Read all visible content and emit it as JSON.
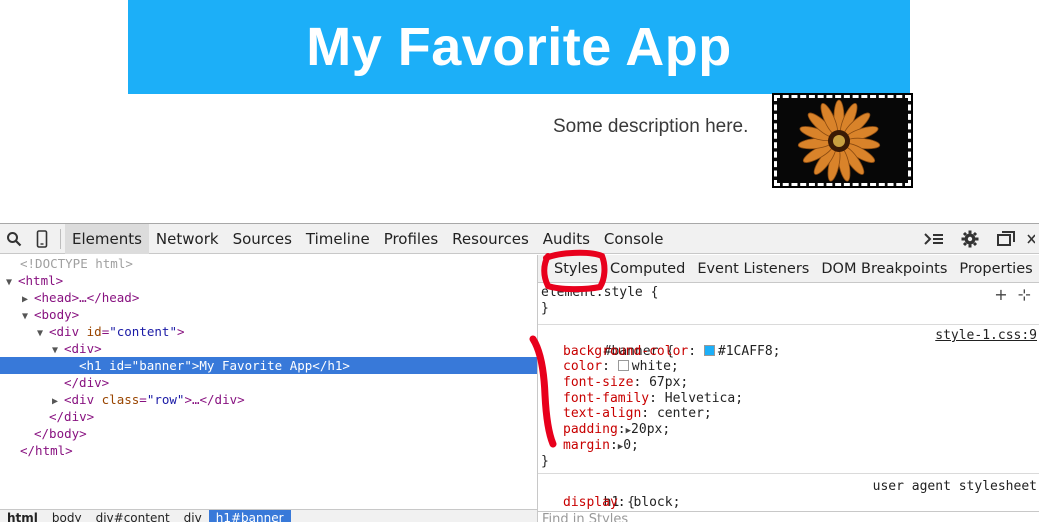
{
  "page": {
    "banner_text": "My Favorite App",
    "description": "Some description here.",
    "image_alt": "flower-image"
  },
  "toolbar": {
    "tabs": [
      "Elements",
      "Network",
      "Sources",
      "Timeline",
      "Profiles",
      "Resources",
      "Audits",
      "Console"
    ],
    "active_tab": "Elements"
  },
  "dom_tree": {
    "doctype": "<!DOCTYPE html>",
    "html_open": "<html>",
    "head": "<head>…</head>",
    "body_open": "<body>",
    "div_content_tag": "<div ",
    "div_content_attr": "id",
    "div_content_val": "\"content\"",
    "div_content_close": ">",
    "div_open": "<div>",
    "h1_line": "<h1 id=\"banner\">My Favorite App</h1>",
    "div_close": "</div>",
    "div_row_tag": "<div ",
    "div_row_attr": "class",
    "div_row_val": "\"row\"",
    "div_row_close": ">…</div>",
    "div_close2": "</div>",
    "body_close": "</body>",
    "html_close": "</html>"
  },
  "breadcrumb": [
    "html",
    "body",
    "div#content",
    "div",
    "h1#banner"
  ],
  "sidebar": {
    "tabs": [
      "Styles",
      "Computed",
      "Event Listeners",
      "DOM Breakpoints",
      "Properties"
    ],
    "element_style": {
      "selector": "element.style {",
      "close": "}",
      "tools": [
        "+",
        "⊹"
      ]
    },
    "banner_rule": {
      "selector": "#banner {",
      "source": "style-1.css:9",
      "declarations": [
        {
          "prop": "background-color",
          "value": "#1CAFF8;",
          "swatch": "#1CAFF8"
        },
        {
          "prop": "color",
          "value": "white;",
          "swatch": "#ffffff"
        },
        {
          "prop": "font-size",
          "value": "67px;"
        },
        {
          "prop": "font-family",
          "value": "Helvetica;"
        },
        {
          "prop": "text-align",
          "value": "center;"
        },
        {
          "prop": "padding",
          "value": "20px;",
          "expandable": true
        },
        {
          "prop": "margin",
          "value": "0;",
          "expandable": true
        }
      ],
      "close": "}"
    },
    "h1_rule": {
      "selector": "h1 {",
      "source": "user agent stylesheet",
      "declarations": [
        {
          "prop": "display",
          "value": "block;"
        }
      ]
    },
    "find_placeholder": "Find in Styles"
  },
  "colors": {
    "banner_bg": "#1CAFF8",
    "selection": "#3879d9",
    "annotation": "#e8001c"
  }
}
